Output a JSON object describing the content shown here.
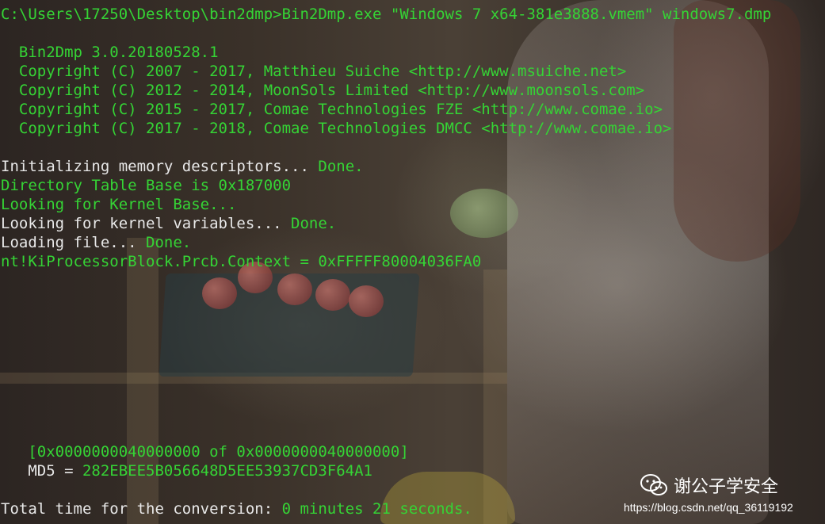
{
  "console": {
    "command": "C:\\Users\\17250\\Desktop\\bin2dmp>Bin2Dmp.exe \"Windows 7 x64-381e3888.vmem\" windows7.dmp",
    "banner": [
      "  Bin2Dmp 3.0.20180528.1",
      "  Copyright (C) 2007 - 2017, Matthieu Suiche <http://www.msuiche.net>",
      "  Copyright (C) 2012 - 2014, MoonSols Limited <http://www.moonsols.com>",
      "  Copyright (C) 2015 - 2017, Comae Technologies FZE <http://www.comae.io>",
      "  Copyright (C) 2017 - 2018, Comae Technologies DMCC <http://www.comae.io>"
    ],
    "init_prefix": "Initializing memory descriptors... ",
    "init_status": "Done.",
    "dtb": "Directory Table Base is 0x187000",
    "kernel_base": "Looking for Kernel Base...",
    "kernel_vars_prefix": "Looking for kernel variables... ",
    "kernel_vars_status": "Done.",
    "loading_prefix": "Loading file... ",
    "loading_status": "Done.",
    "context": "nt!KiProcessorBlock.Prcb.Context = 0xFFFFF80004036FA0",
    "progress": "   [0x0000000040000000 of 0x0000000040000000]",
    "md5_prefix": "   MD5 = ",
    "md5_value": "282EBEE5B056648D5EE53937CD3F64A1",
    "total_prefix": "Total time for the conversion: ",
    "total_value": "0 minutes 21 seconds."
  },
  "watermark": {
    "name": "谢公子学安全",
    "url": "https://blog.csdn.net/qq_36119192"
  },
  "colors": {
    "white_text": "#e8e8e8",
    "green_text": "#35d435"
  }
}
